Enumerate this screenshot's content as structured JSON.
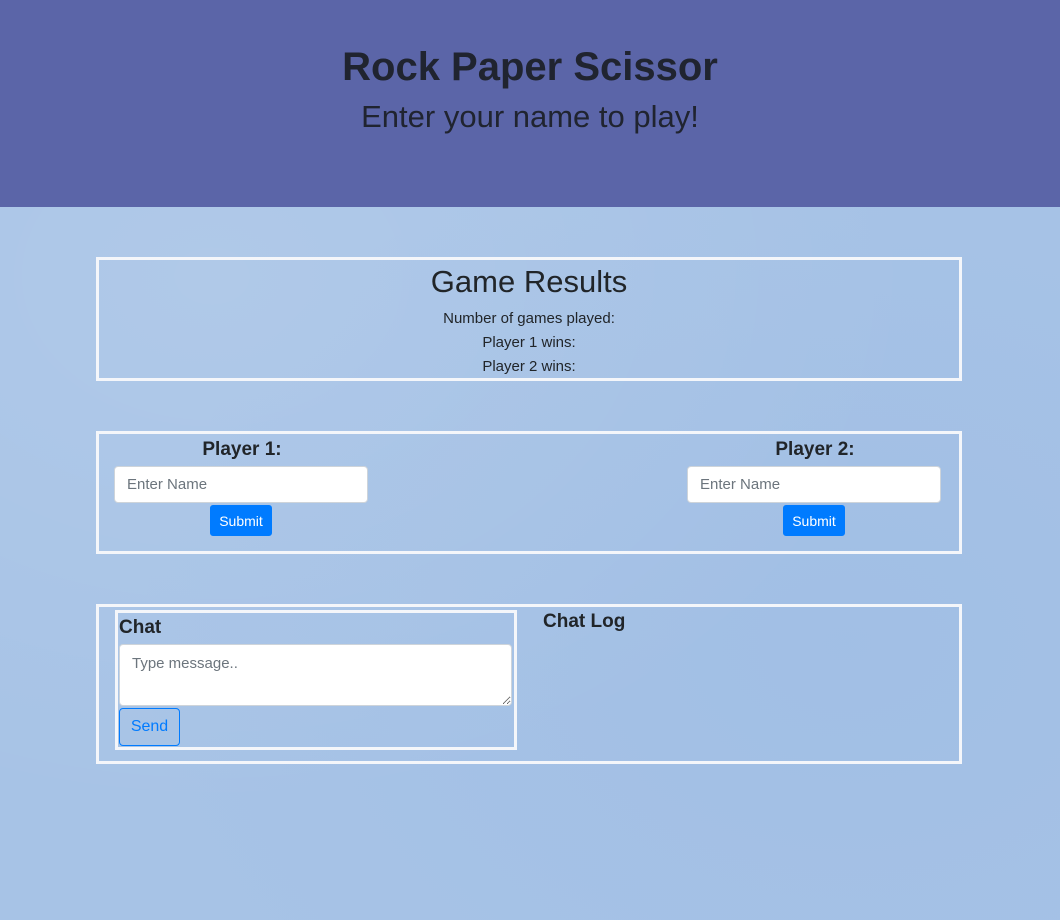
{
  "header": {
    "title": "Rock Paper Scissor",
    "subtitle": "Enter your name to play!"
  },
  "results": {
    "title": "Game Results",
    "games_played_label": "Number of games played:",
    "player1_wins_label": "Player 1 wins:",
    "player2_wins_label": "Player 2 wins:"
  },
  "players": [
    {
      "label": "Player 1:",
      "name_placeholder": "Enter Name",
      "name_value": "",
      "submit_label": "Submit"
    },
    {
      "label": "Player 2:",
      "name_placeholder": "Enter Name",
      "name_value": "",
      "submit_label": "Submit"
    }
  ],
  "chat": {
    "title": "Chat",
    "message_placeholder": "Type message..",
    "message_value": "",
    "send_label": "Send",
    "log_title": "Chat Log"
  },
  "colors": {
    "header_bg": "#5b65a8",
    "page_bg": "#a7c3e6",
    "primary": "#007bff",
    "box_border": "#f4f6fa"
  }
}
